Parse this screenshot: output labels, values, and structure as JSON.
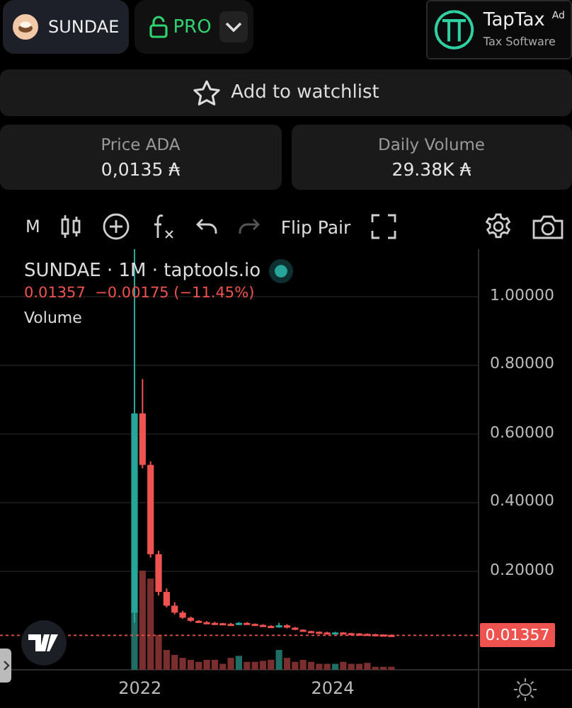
{
  "header": {
    "token": "SUNDAE",
    "pro_label": "PRO",
    "ad": {
      "title": "TapTax",
      "badge": "Ad",
      "subtitle": "Tax Software"
    }
  },
  "watchlist": {
    "label": "Add to watchlist"
  },
  "stats": [
    {
      "label": "Price ADA",
      "value": "0,0135 ₳"
    },
    {
      "label": "Daily Volume",
      "value": "29.38K ₳"
    }
  ],
  "toolbar": {
    "interval": "M",
    "flip_label": "Flip Pair",
    "undo_disabled": false,
    "redo_disabled": true
  },
  "chart": {
    "title": "SUNDAE · 1M · taptools.io",
    "quote": "0.01357  −0.00175 (−11.45%)",
    "volume_label": "Volume",
    "last_price": "0.01357",
    "price_axis_labels": [
      "1.00000",
      "0.80000",
      "0.60000",
      "0.40000",
      "0.20000"
    ],
    "time_axis_labels": [
      "2022",
      "2024"
    ]
  }
}
